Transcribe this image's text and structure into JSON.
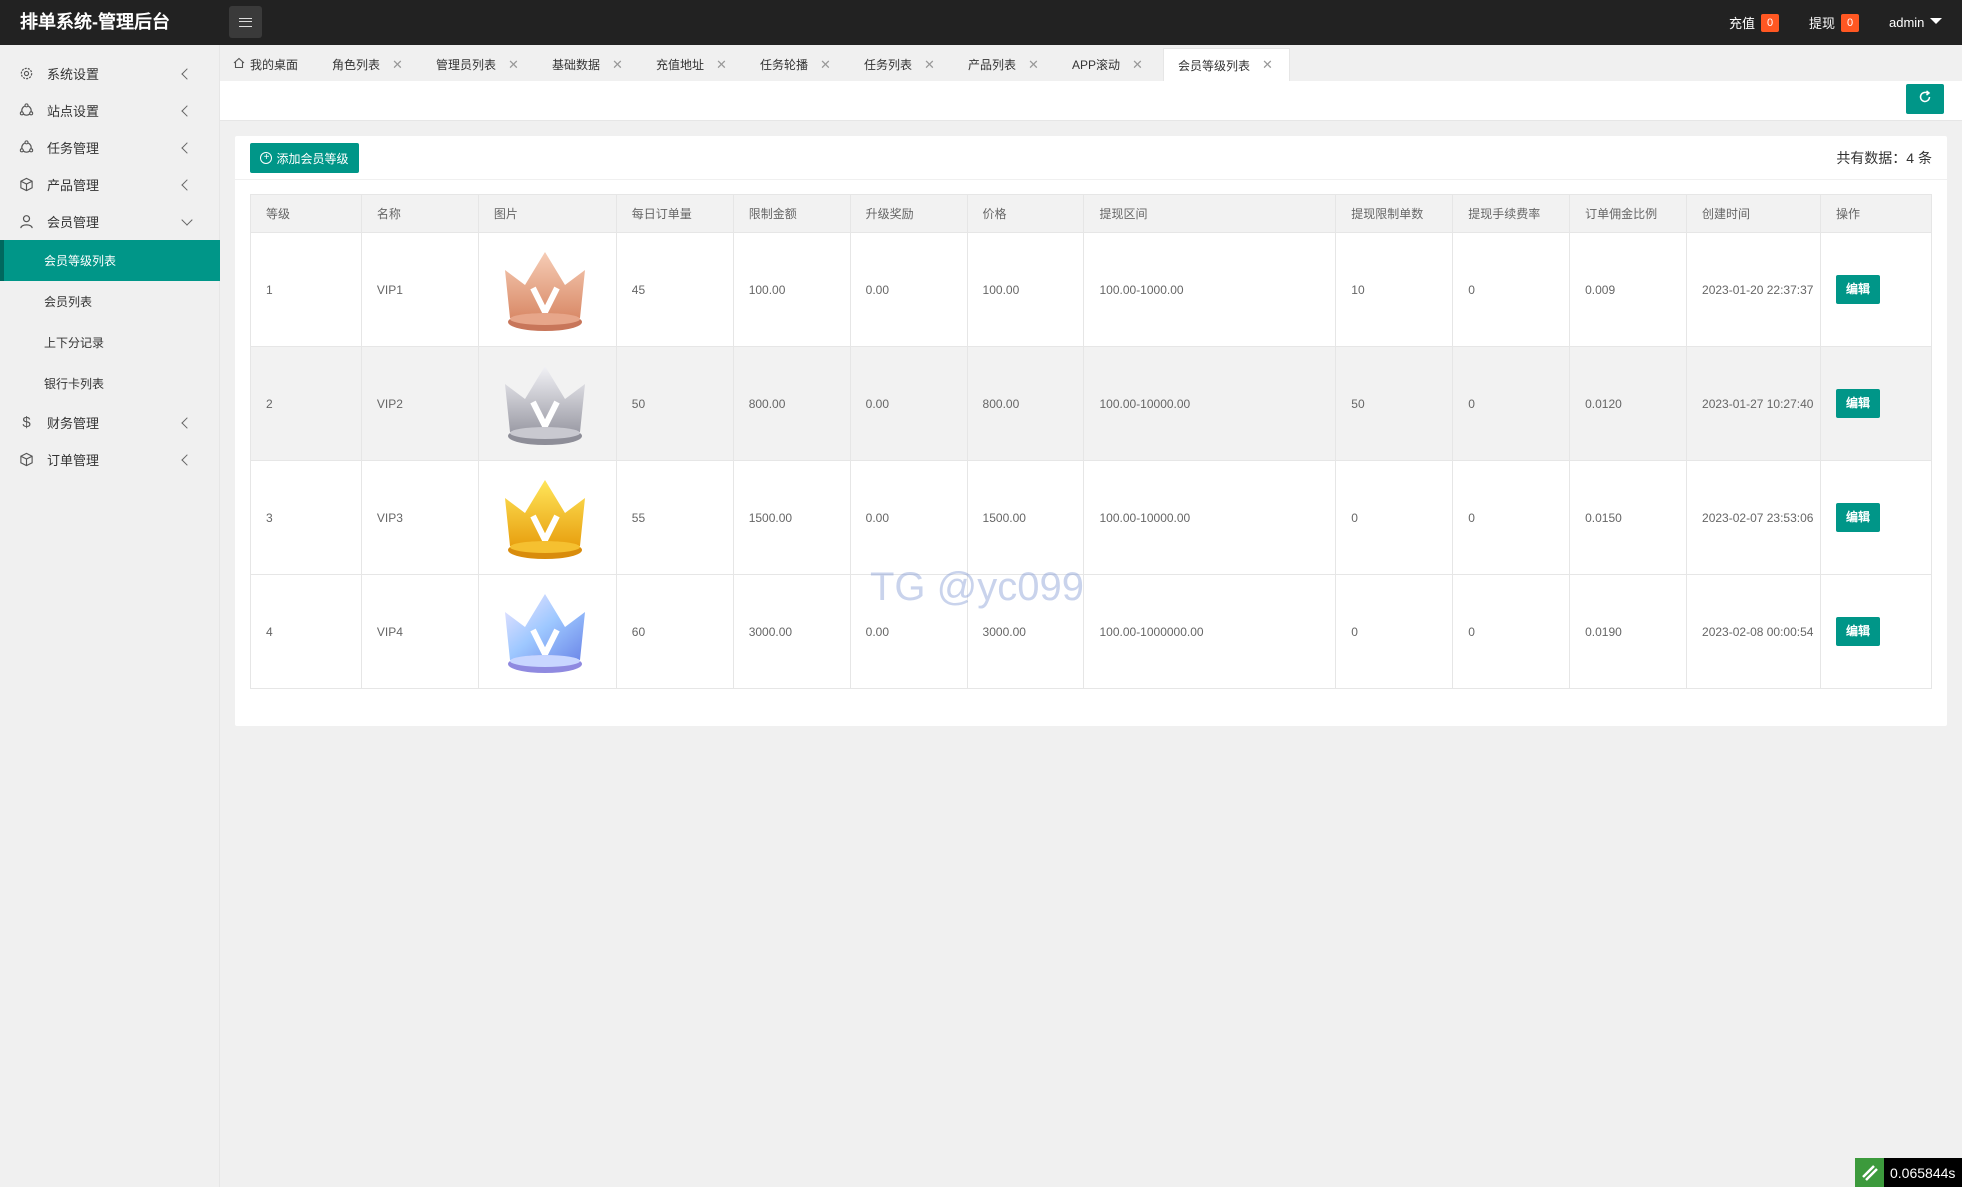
{
  "app": {
    "title": "排单系统-管理后台"
  },
  "header": {
    "recharge_label": "充值",
    "recharge_count": "0",
    "withdraw_label": "提现",
    "withdraw_count": "0",
    "user": "admin"
  },
  "sidebar": {
    "items": [
      {
        "label": "系统设置",
        "icon": "gear-icon"
      },
      {
        "label": "站点设置",
        "icon": "site-icon"
      },
      {
        "label": "任务管理",
        "icon": "task-icon"
      },
      {
        "label": "产品管理",
        "icon": "cube-icon"
      },
      {
        "label": "会员管理",
        "icon": "user-icon"
      },
      {
        "label": "财务管理",
        "icon": "dollar-icon"
      },
      {
        "label": "订单管理",
        "icon": "box-icon"
      }
    ],
    "subitems": [
      {
        "label": "会员等级列表",
        "active": true
      },
      {
        "label": "会员列表"
      },
      {
        "label": "上下分记录"
      },
      {
        "label": "银行卡列表"
      }
    ]
  },
  "tabs": [
    {
      "label": "我的桌面"
    },
    {
      "label": "角色列表"
    },
    {
      "label": "管理员列表"
    },
    {
      "label": "基础数据"
    },
    {
      "label": "充值地址"
    },
    {
      "label": "任务轮播"
    },
    {
      "label": "任务列表"
    },
    {
      "label": "产品列表"
    },
    {
      "label": "APP滚动"
    },
    {
      "label": "会员等级列表"
    }
  ],
  "tab_close": "✕",
  "card": {
    "add_label": "添加会员等级",
    "count_text": "共有数据：4 条"
  },
  "table": {
    "headers": [
      "等级",
      "名称",
      "图片",
      "每日订单量",
      "限制金额",
      "升级奖励",
      "价格",
      "提现区间",
      "提现限制单数",
      "提现手续费率",
      "订单佣金比例",
      "创建时间",
      "操作"
    ],
    "rows": [
      {
        "level": "1",
        "name": "VIP1",
        "crown": "bronze",
        "daily": "45",
        "limit": "100.00",
        "bonus": "0.00",
        "price": "100.00",
        "range": "100.00-1000.00",
        "wd_limit": "10",
        "fee": "0",
        "commission": "0.009",
        "created": "2023-01-20 22:37:37",
        "action": "编辑"
      },
      {
        "level": "2",
        "name": "VIP2",
        "crown": "silver",
        "daily": "50",
        "limit": "800.00",
        "bonus": "0.00",
        "price": "800.00",
        "range": "100.00-10000.00",
        "wd_limit": "50",
        "fee": "0",
        "commission": "0.0120",
        "created": "2023-01-27 10:27:40",
        "action": "编辑"
      },
      {
        "level": "3",
        "name": "VIP3",
        "crown": "gold",
        "daily": "55",
        "limit": "1500.00",
        "bonus": "0.00",
        "price": "1500.00",
        "range": "100.00-10000.00",
        "wd_limit": "0",
        "fee": "0",
        "commission": "0.0150",
        "created": "2023-02-07 23:53:06",
        "action": "编辑"
      },
      {
        "level": "4",
        "name": "VIP4",
        "crown": "crystal",
        "daily": "60",
        "limit": "3000.00",
        "bonus": "0.00",
        "price": "3000.00",
        "range": "100.00-1000000.00",
        "wd_limit": "0",
        "fee": "0",
        "commission": "0.0190",
        "created": "2023-02-08 00:00:54",
        "action": "编辑"
      }
    ]
  },
  "watermark": "TG @yc099",
  "timer": "0.065844s",
  "colors": {
    "accent": "#009688",
    "topbar": "#222222",
    "badge": "#ff5722"
  }
}
